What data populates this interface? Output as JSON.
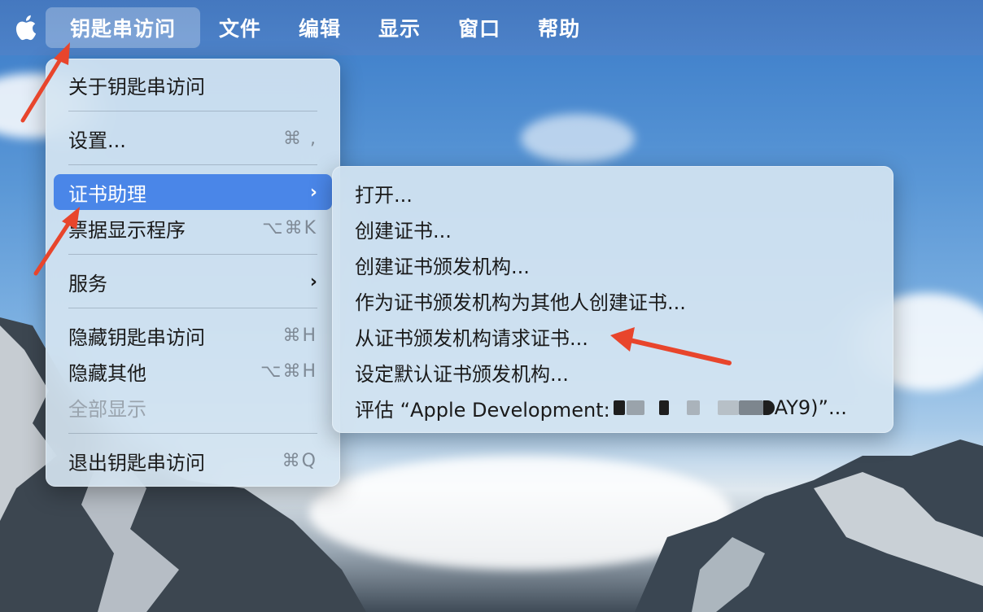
{
  "menubar": {
    "apple_icon": "apple-logo-icon",
    "items": [
      {
        "label": "钥匙串访问",
        "active": true
      },
      {
        "label": "文件"
      },
      {
        "label": "编辑"
      },
      {
        "label": "显示"
      },
      {
        "label": "窗口"
      },
      {
        "label": "帮助"
      }
    ]
  },
  "main_menu": {
    "about": "关于钥匙串访问",
    "settings": {
      "label": "设置...",
      "shortcut": "⌘ ,"
    },
    "cert_assistant": {
      "label": "证书助理",
      "submenu_icon": "chevron-right-icon"
    },
    "ticket_viewer": {
      "label": "票据显示程序",
      "shortcut": "⌥⌘K"
    },
    "services": {
      "label": "服务",
      "submenu_icon": "chevron-right-icon"
    },
    "hide": {
      "label": "隐藏钥匙串访问",
      "shortcut": "⌘H"
    },
    "hide_others": {
      "label": "隐藏其他",
      "shortcut": "⌥⌘H"
    },
    "show_all": {
      "label": "全部显示",
      "disabled": true
    },
    "quit": {
      "label": "退出钥匙串访问",
      "shortcut": "⌘Q"
    }
  },
  "submenu": {
    "items": [
      "打开...",
      "创建证书...",
      "创建证书颁发机构...",
      "作为证书颁发机构为其他人创建证书...",
      "从证书颁发机构请求证书...",
      "设定默认证书颁发机构...",
      "评估 “Apple Development: "
    ],
    "evaluate_suffix": "AY9)”..."
  },
  "annotations": {
    "arrow_color": "#e8452c",
    "highlight_color": "#4a86e8"
  }
}
